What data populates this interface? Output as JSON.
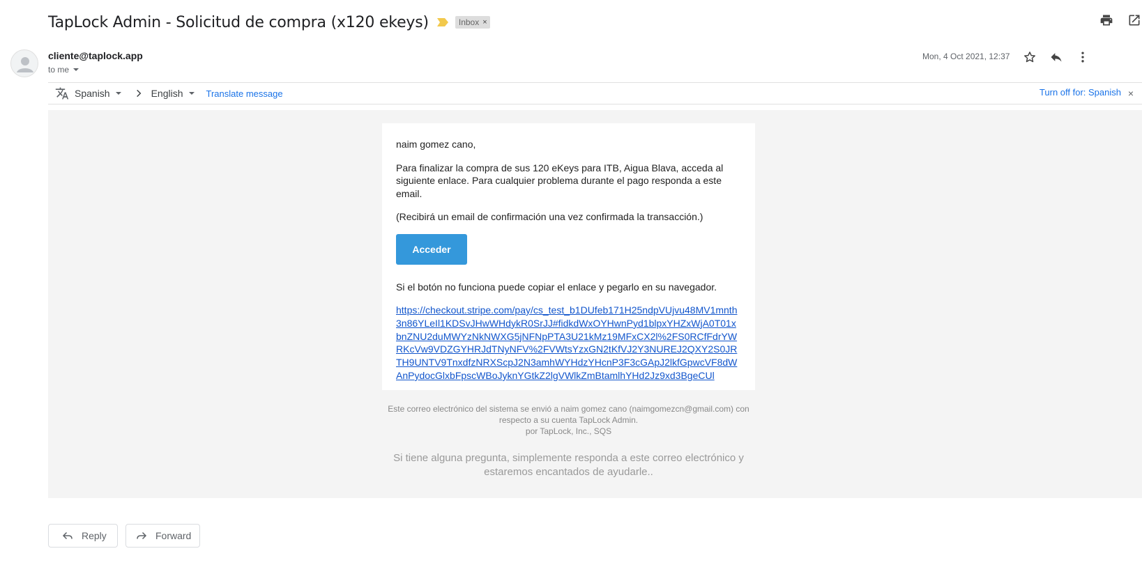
{
  "email": {
    "subject": "TapLock Admin - Solicitud de compra (x120 ekeys)",
    "label_chip": "Inbox",
    "label_chip_close": "×",
    "sender": "cliente@taplock.app",
    "recipient": "to me",
    "date": "Mon, 4 Oct 2021, 12:37"
  },
  "icons": {
    "importance": "importance-marker-icon",
    "print": "print-icon",
    "open_new_window": "open-in-new-window-icon",
    "star": "star-icon",
    "reply": "reply-icon",
    "more": "more-vert-icon",
    "translate": "translate-icon",
    "avatar": "default-avatar-icon"
  },
  "translate_bar": {
    "source_language": "Spanish",
    "target_language": "English",
    "translate_link": "Translate message",
    "turn_off": "Turn off for: Spanish",
    "close": "×"
  },
  "body": {
    "greeting": "naim gomez cano,",
    "paragraph1": "Para finalizar la compra de sus 120 eKeys para ITB, Aigua Blava, acceda al siguiente enlace. Para cualquier problema durante el pago responda a este email.",
    "paragraph2": "(Recibirá un email de confirmación una vez confirmada la transacción.)",
    "button_label": "Acceder",
    "paragraph3": "Si el botón no funciona puede copiar el enlace y pegarlo en su navegador.",
    "url": "https://checkout.stripe.com/pay/cs_test_b1DUfeb171H25ndpVUjvu48MV1mnth3n86YLeIl1KDSvJHwWHdykR0SrJJ#fidkdWxOYHwnPyd1blpxYHZxWjA0T01xbnZNU2duMWYzNkNWXG5jNFNpPTA3U21kMz19MFxCX2l%2FS0RCfFdrYWRKcVw9VDZGYHRJdTNyNFV%2FVWtsYzxGN2tKfVJ2Y3NUREJ2QXY2S0JRTH9UNTV9TnxdfzNRXScpJ2N3amhWYHdzYHcnP3F3cGApJ2lkfGpwcVF8dWAnPydocGlxbFpscWBoJyknYGtkZ2lgVWlkZmBtamlhYHd2Jz9xd3BgeCUl"
  },
  "footer": {
    "line1": "Este correo electrónico del sistema se envió a naim gomez cano (naimgomezcn@gmail.com) con respecto a su cuenta TapLock Admin.",
    "line2": "por TapLock, Inc., SQS",
    "help": "Si tiene alguna pregunta, simplemente responda a este correo electrónico y estaremos encantados de ayudarle.."
  },
  "actions": {
    "reply": "Reply",
    "forward": "Forward"
  },
  "colors": {
    "link": "#1155cc",
    "gmail_blue": "#1a73e8",
    "button_bg": "#3498db",
    "importance": "#f2c94c"
  }
}
